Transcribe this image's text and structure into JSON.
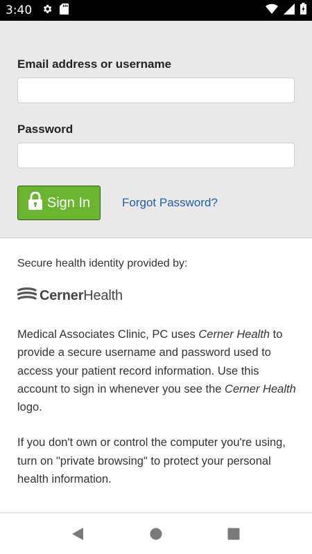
{
  "status_bar": {
    "time": "3:40",
    "icons": [
      "gear-icon",
      "sd-card-icon",
      "wifi-icon",
      "cellular-signal-icon",
      "battery-icon"
    ]
  },
  "login": {
    "email_label": "Email address or username",
    "email_value": "",
    "password_label": "Password",
    "password_value": "",
    "signin_label": "Sign In",
    "forgot_label": "Forgot Password?"
  },
  "info": {
    "heading": "Secure health identity provided by:",
    "brand_logo_text": "CernerHealth",
    "para1_a": "Medical Associates Clinic, PC uses ",
    "para1_b": "Cerner Health",
    "para1_c": " to provide a secure username and password used to access your patient record information. Use this account to sign in whenever you see the ",
    "para1_d": "Cerner Health",
    "para1_e": " logo.",
    "para2": "If you don't own or control the computer you're using, turn on \"private browsing\" to protect your personal health information."
  },
  "colors": {
    "signin_green": "#6ab42f",
    "link_blue": "#1f5fa8",
    "panel_gray": "#e9e9e9"
  },
  "nav_bar": {
    "icons": [
      "back-icon",
      "home-icon",
      "recents-icon"
    ]
  }
}
